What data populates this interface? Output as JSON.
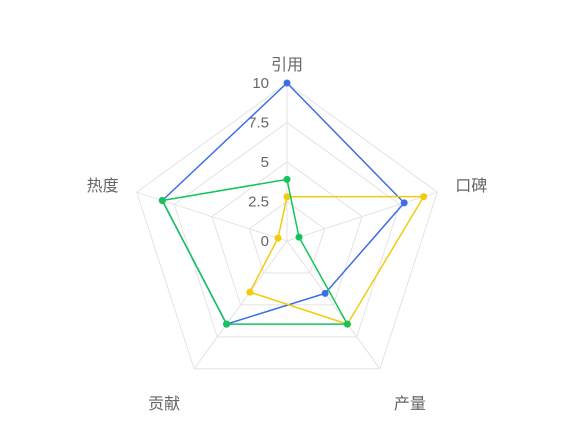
{
  "chart_data": {
    "type": "radar",
    "axes": [
      "引用",
      "口碑",
      "产量",
      "贡献",
      "热度"
    ],
    "rlim": [
      0,
      10
    ],
    "ticks": [
      "0",
      "2.5",
      "5",
      "7.5",
      "10"
    ],
    "grid": true,
    "legend": "none",
    "series": [
      {
        "color": "#3d6ee8",
        "values": [
          10,
          7.8,
          4.1,
          6.5,
          8.3
        ]
      },
      {
        "color": "#f2cc0c",
        "values": [
          2.8,
          9.1,
          6.5,
          4.0,
          0.6
        ]
      },
      {
        "color": "#14c45a",
        "values": [
          3.9,
          0.8,
          6.5,
          6.5,
          8.3
        ]
      }
    ]
  },
  "colors": {
    "grid": "#e3e3e3",
    "label": "#666666"
  }
}
